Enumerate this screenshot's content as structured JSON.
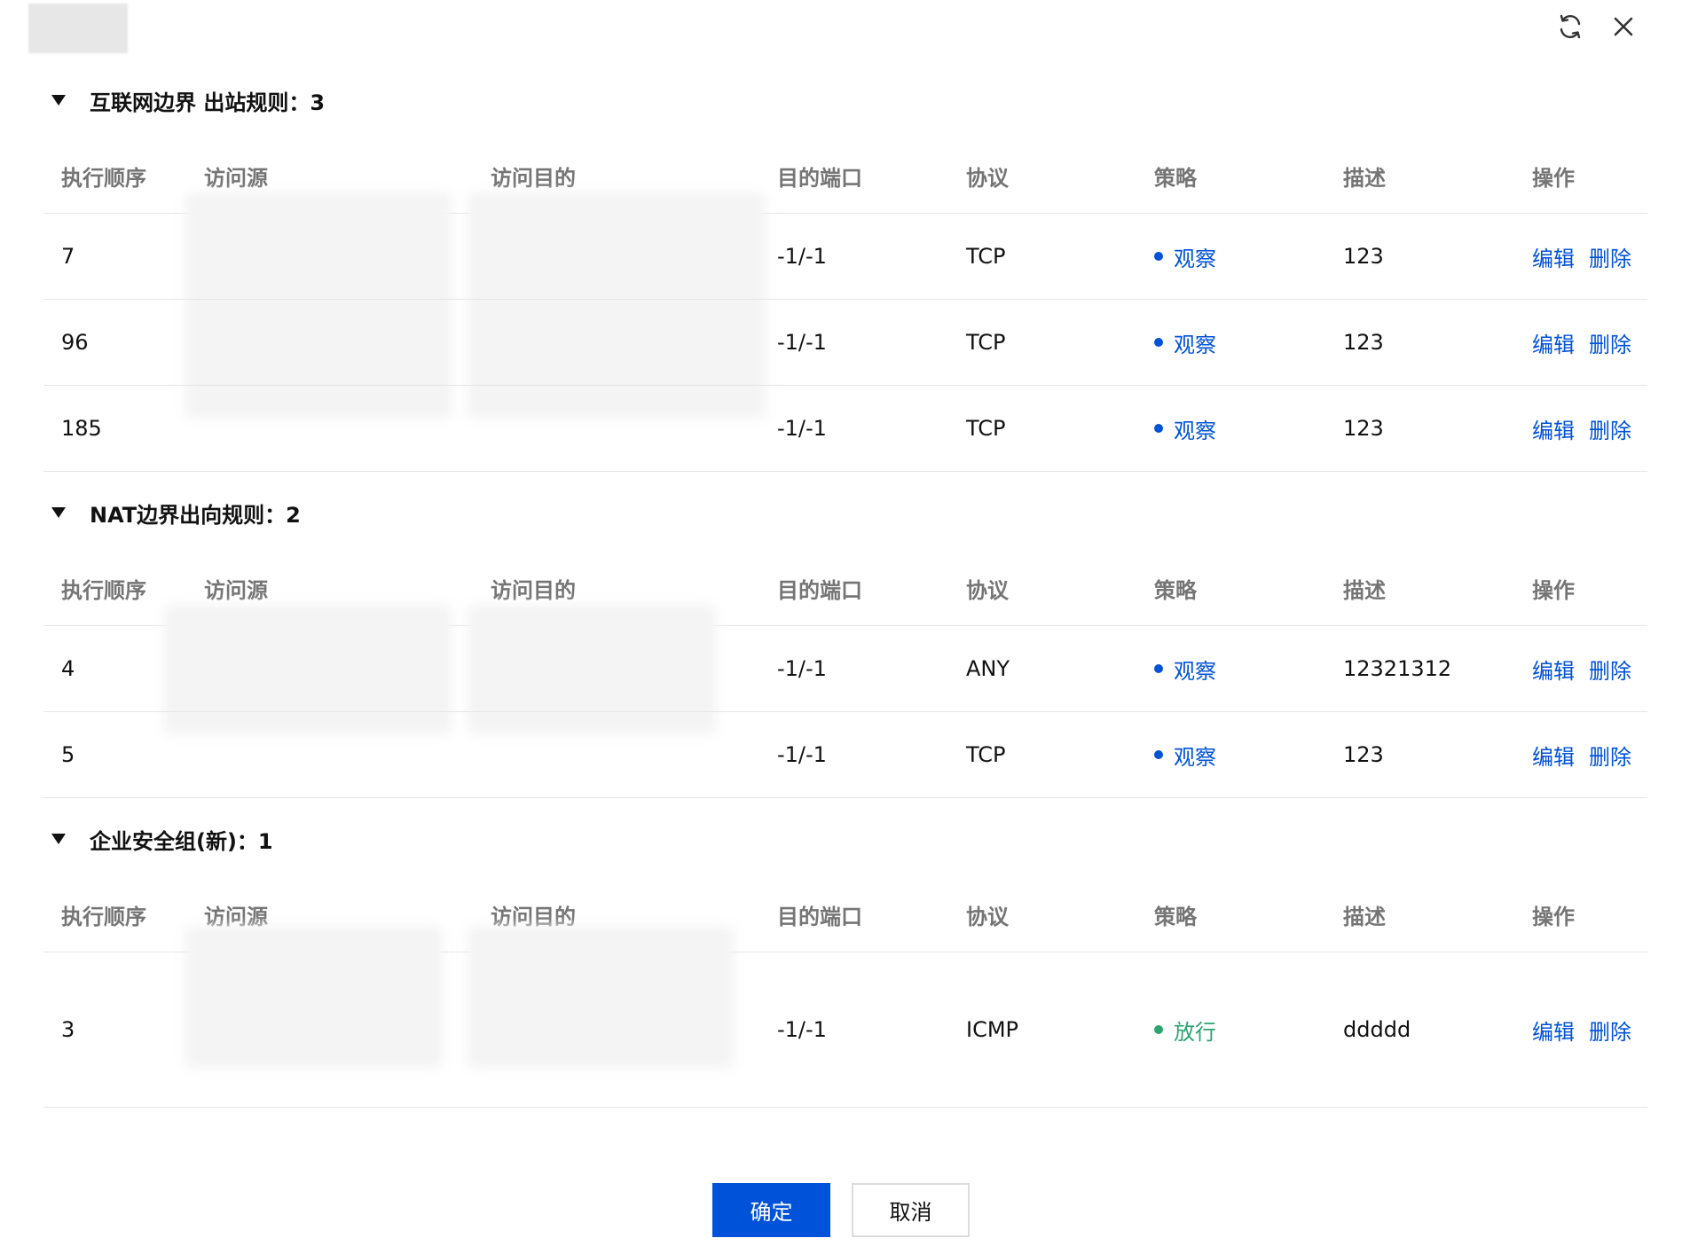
{
  "header": {
    "icons": {
      "refresh": "refresh-icon",
      "close": "close-icon"
    }
  },
  "columns": [
    "执行顺序",
    "访问源",
    "访问目的",
    "目的端口",
    "协议",
    "策略",
    "描述",
    "操作"
  ],
  "actions": {
    "edit": "编辑",
    "delete": "删除"
  },
  "colors": {
    "observe": "#0052d9",
    "allow": "#2ba471",
    "link": "#0052d9"
  },
  "sections": [
    {
      "title": "互联网边界 出站规则：3",
      "rows": [
        {
          "order": "7",
          "port": "-1/-1",
          "protocol": "TCP",
          "policy": "观察",
          "desc": "123"
        },
        {
          "order": "96",
          "port": "-1/-1",
          "protocol": "TCP",
          "policy": "观察",
          "desc": "123"
        },
        {
          "order": "185",
          "port": "-1/-1",
          "protocol": "TCP",
          "policy": "观察",
          "desc": "123"
        }
      ]
    },
    {
      "title": "NAT边界出向规则：2",
      "rows": [
        {
          "order": "4",
          "port": "-1/-1",
          "protocol": "ANY",
          "policy": "观察",
          "desc": "12321312"
        },
        {
          "order": "5",
          "port": "-1/-1",
          "protocol": "TCP",
          "policy": "观察",
          "desc": "123"
        }
      ]
    },
    {
      "title": "企业安全组(新)：1",
      "rows": [
        {
          "order": "3",
          "port": "-1/-1",
          "protocol": "ICMP",
          "policy": "放行",
          "desc": "ddddd"
        }
      ]
    }
  ],
  "footer": {
    "confirm": "确定",
    "cancel": "取消"
  }
}
